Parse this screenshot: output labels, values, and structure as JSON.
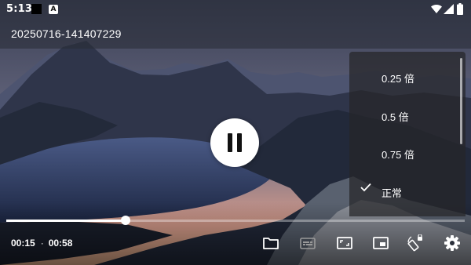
{
  "status_bar": {
    "time": "5:13",
    "notification_icons": [
      "square-notification-icon",
      "a-notification-icon"
    ],
    "notif_letter": "A",
    "right_icons": [
      "wifi-icon",
      "signal-icon",
      "battery-icon"
    ]
  },
  "player": {
    "title": "20250716-141407229",
    "state": "playing",
    "current_time": "00:15",
    "separator": "·",
    "total_time": "00:58",
    "progress": 0.26
  },
  "controls": {
    "icons": [
      "folder-icon",
      "subtitles-icon",
      "aspect-ratio-icon",
      "picture-in-picture-icon",
      "rotate-lock-icon",
      "settings-icon"
    ]
  },
  "speed_menu": {
    "items": [
      {
        "label": "0.25 倍",
        "selected": false
      },
      {
        "label": "0.5 倍",
        "selected": false
      },
      {
        "label": "0.75 倍",
        "selected": false
      },
      {
        "label": "正常",
        "selected": true
      }
    ]
  },
  "colors": {
    "accent": "#ffffff",
    "menu_background": "#262628"
  }
}
